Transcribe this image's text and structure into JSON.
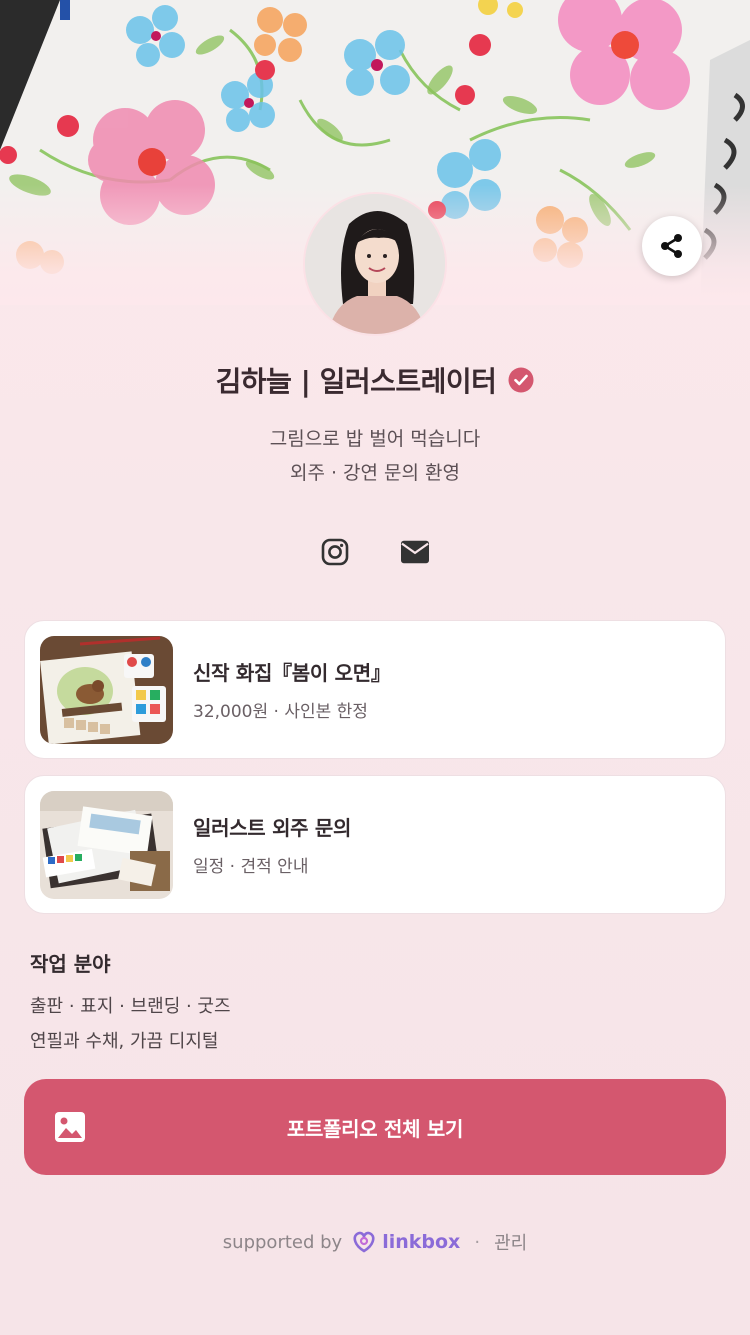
{
  "profile": {
    "name": "김하늘 | 일러스트레이터",
    "bio_line1": "그림으로 밥 벌어 먹습니다",
    "bio_line2": "외주 · 강연 문의 환영",
    "verified_icon": "verified-check-icon"
  },
  "header": {
    "share_icon": "share-icon"
  },
  "socials": [
    {
      "name": "instagram",
      "icon": "instagram-icon"
    },
    {
      "name": "email",
      "icon": "envelope-icon"
    }
  ],
  "links": [
    {
      "title": "신작 화집『봄이 오면』",
      "subtitle": "32,000원 · 사인본 한정",
      "thumbnail": "watercolor-bird-painting"
    },
    {
      "title": "일러스트 외주 문의",
      "subtitle": "일정 · 견적 안내",
      "thumbnail": "art-supplies-desk"
    }
  ],
  "work": {
    "title": "작업 분야",
    "line1": "출판 · 표지 · 브랜딩 · 굿즈",
    "line2": "연필과 수채, 가끔 디지털"
  },
  "cta": {
    "label": "포트폴리오 전체 보기",
    "icon": "image-icon"
  },
  "footer": {
    "supported_by": "supported by",
    "brand": "linkbox",
    "separator": "·",
    "manage": "관리"
  },
  "colors": {
    "accent": "#d4576f",
    "background": "#fde8ec",
    "brand": "#8b6bd8"
  }
}
